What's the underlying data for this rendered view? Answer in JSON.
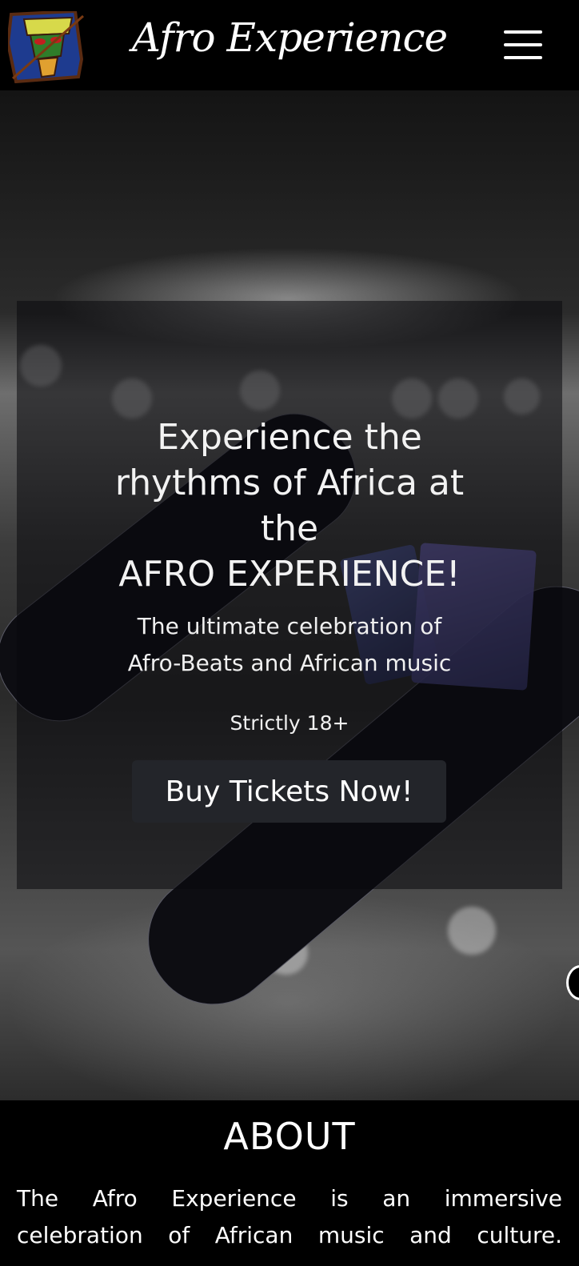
{
  "header": {
    "brand": "Afro Experience",
    "logo_icon": "african-mask-logo-icon",
    "menu_icon": "hamburger-menu-icon"
  },
  "hero": {
    "title_lines": [
      "Experience the",
      "rhythms of Africa at",
      "the",
      "AFRO EXPERIENCE!"
    ],
    "subtitle_lines": [
      "The ultimate celebration of",
      "Afro-Beats and African music"
    ],
    "age_notice": "Strictly 18+",
    "cta_label": "Buy Tickets Now!"
  },
  "about": {
    "heading": "ABOUT",
    "text": "The Afro Experience is an immersive celebration of African music and culture."
  },
  "colors": {
    "background": "#000000",
    "button": "#23252a",
    "text": "#ffffff"
  }
}
